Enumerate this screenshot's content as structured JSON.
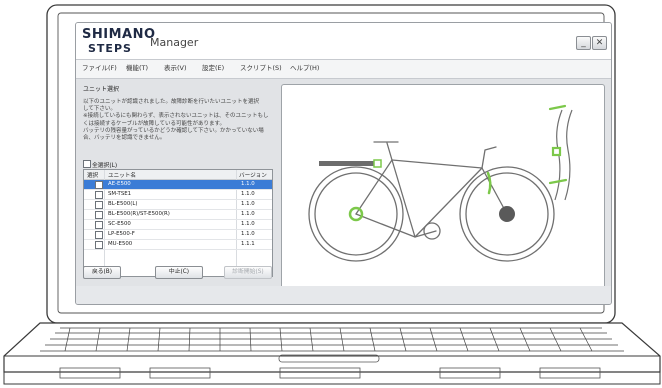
{
  "window": {
    "logo_text": "SHIMANO",
    "logo_sub": "STEPS",
    "title": "Manager",
    "minimize_label": "_",
    "close_label": "✕"
  },
  "menu": [
    {
      "label": "ファイル(F)"
    },
    {
      "label": "機能(T)"
    },
    {
      "label": "表示(V)"
    },
    {
      "label": "設定(E)"
    },
    {
      "label": "スクリプト(S)"
    },
    {
      "label": "ヘルプ(H)"
    }
  ],
  "panel": {
    "heading": "ユニット選択",
    "instructions": "以下のユニットが認識されました。故障診断を行いたいユニットを選択\nして下さい。\n※接続しているにも関わらず、表示されないユニットは、そのユニットもし\nくは接続するケーブルが故障している可能性があります。\nバッテリの残容量がっているかどうか確認して下さい。かかっていない場\n合、バッテリを認識できません。",
    "select_all_label": "全選択(L)"
  },
  "table": {
    "columns": [
      "選択",
      "ユニット名",
      "バージョン"
    ],
    "rows": [
      {
        "name": "AE-E500",
        "version": "1.1.0",
        "selected": true
      },
      {
        "name": "SM-TSE1",
        "version": "1.1.0",
        "selected": false
      },
      {
        "name": "BL-E500(L)",
        "version": "1.1.0",
        "selected": false
      },
      {
        "name": "BL-E500(R)/ST-E500(R)",
        "version": "1.1.0",
        "selected": false
      },
      {
        "name": "SC-E500",
        "version": "1.1.0",
        "selected": false
      },
      {
        "name": "LP-E500-F",
        "version": "1.1.0",
        "selected": false
      },
      {
        "name": "MU-E500",
        "version": "1.1.1",
        "selected": false
      }
    ]
  },
  "buttons": {
    "back": "戻る(B)",
    "stop": "中止(C)",
    "diagnose": "診断開始(S)"
  },
  "colors": {
    "selected_row": "#3b7cd6",
    "highlight_green": "#7cc84a",
    "bike_stroke": "#707070"
  }
}
